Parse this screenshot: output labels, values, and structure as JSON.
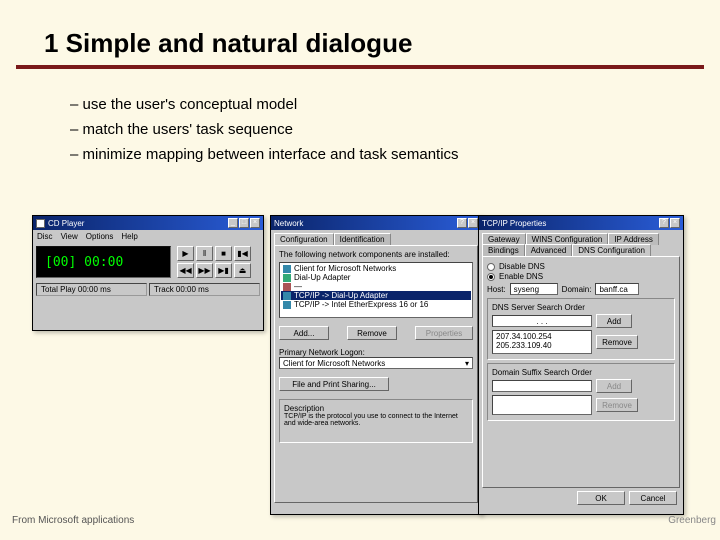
{
  "title": "1 Simple and natural dialogue",
  "bullets": [
    "use the user's conceptual model",
    "match the users' task sequence",
    "minimize mapping between interface and task semantics"
  ],
  "footer_left": "From Microsoft applications",
  "footer_right": "Greenberg",
  "cdplayer": {
    "title": "CD Player",
    "menu": [
      "Disc",
      "View",
      "Options",
      "Help"
    ],
    "display": "[00] 00:00",
    "status_left": "Total Play 00:00 ms",
    "status_right": "Track 00:00 ms",
    "transport": [
      "▶",
      "‖",
      "■",
      "▮◀",
      "◀◀",
      "▶▶",
      "▶▮",
      "⏏"
    ]
  },
  "network": {
    "title": "Network",
    "tab_active": "Configuration",
    "tab_inactive": "Identification",
    "list_label": "The following network components are installed:",
    "items": [
      "Client for Microsoft Networks",
      "Dial-Up Adapter",
      "—",
      "TCP/IP -> Dial-Up Adapter",
      "TCP/IP -> Intel EtherExpress 16 or 16"
    ],
    "btn_add": "Add...",
    "btn_remove": "Remove",
    "logon_label": "Primary Network Logon:",
    "logon_value": "Client for Microsoft Networks",
    "btn_share": "File and Print Sharing...",
    "desc_label": "Description",
    "desc_text": "TCP/IP is the protocol you use to connect to the Internet and wide-area networks."
  },
  "tcpip": {
    "title": "TCP/IP Properties",
    "tabs_row1": [
      "Gateway",
      "WINS Configuration",
      "IP Address"
    ],
    "tabs_row2": [
      "Bindings",
      "Advanced",
      "DNS Configuration"
    ],
    "radio_disable": "Disable DNS",
    "radio_enable": "Enable DNS",
    "host_label": "Host:",
    "host_value": "syseng",
    "domain_label": "Domain:",
    "domain_value": "banff.ca",
    "search_label": "DNS Server Search Order",
    "search_dots": ".   .   .",
    "btn_add1": "Add",
    "servers": [
      "207.34.100.254",
      "205.233.109.40"
    ],
    "btn_remove1": "Remove",
    "suffix_label": "Domain Suffix Search Order",
    "btn_add2": "Add",
    "btn_remove2": "Remove",
    "btn_ok": "OK",
    "btn_cancel": "Cancel"
  }
}
